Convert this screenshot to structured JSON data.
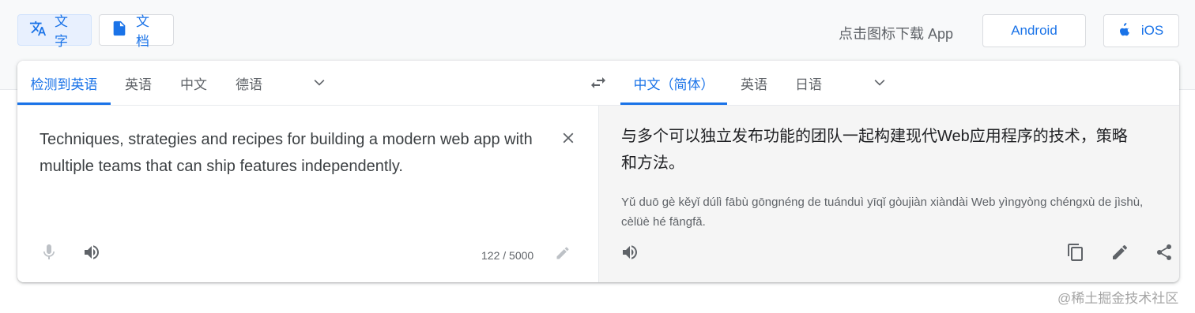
{
  "modes": {
    "text_label": "文字",
    "doc_label": "文档"
  },
  "app_download": {
    "label": "点击图标下载 App",
    "android_label": "Android",
    "ios_label": "iOS"
  },
  "source": {
    "tabs": [
      "检测到英语",
      "英语",
      "中文",
      "德语"
    ],
    "active_tab": "检测到英语",
    "text": "Techniques, strategies and recipes for building a modern web app with multiple teams that can ship features independently.",
    "char_count": "122 / 5000"
  },
  "target": {
    "tabs": [
      "中文（简体）",
      "英语",
      "日语"
    ],
    "active_tab": "中文（简体）",
    "text": "与多个可以独立发布功能的团队一起构建现代Web应用程序的技术，策略和方法。",
    "romanization": "Yǔ duō gè kěyǐ dúlì fābù gōngnéng de tuánduì yīqǐ gòujiàn xiàndài Web yìngyòng chéngxù de jìshù, cèlüè hé fāngfǎ."
  },
  "watermark": "@稀土掘金技术社区",
  "colors": {
    "accent": "#1a73e8",
    "icon": "#5f6368",
    "target_bg": "#f5f5f5",
    "active_mode_bg": "#e8f0fe"
  },
  "icons": [
    "translate-icon",
    "document-icon",
    "apple-icon",
    "chevron-down-icon",
    "swap-icon",
    "close-icon",
    "mic-icon",
    "speaker-icon",
    "pencil-icon",
    "copy-icon",
    "share-icon"
  ]
}
